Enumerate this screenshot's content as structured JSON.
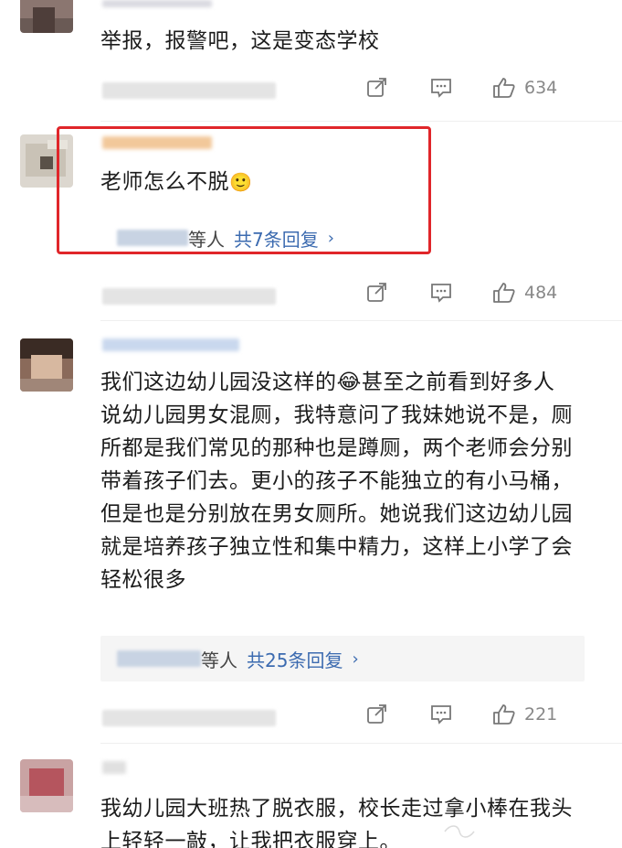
{
  "comments": [
    {
      "text": "举报，报警吧，这是变态学校",
      "likes": "634"
    },
    {
      "text": "老师怎么不脱",
      "emoji": "🙂",
      "replies": {
        "suffix": "等人",
        "link": "共7条回复",
        "chevron": "›"
      },
      "likes": "484"
    },
    {
      "text": "我们这边幼儿园没这样的😂甚至之前看到好多人说幼儿园男女混厕，我特意问了我妹她说不是，厕所都是我们常见的那种也是蹲厕，两个老师会分别带着孩子们去。更小的孩子不能独立的有小马桶，但是也是分别放在男女厕所。她说我们这边幼儿园就是培养孩子独立性和集中精力，这样上小学了会轻松很多",
      "replies": {
        "suffix": "等人",
        "link": "共25条回复",
        "chevron": "›"
      },
      "likes": "221"
    },
    {
      "text": "我幼儿园大班热了脱衣服，校长走过拿小棒在我头上轻轻一敲，让我把衣服穿上。"
    }
  ],
  "icons": {
    "share": "share-icon",
    "comment": "comment-icon",
    "like": "thumbs-up-icon"
  },
  "colors": {
    "highlight_border": "#e0262a",
    "reply_link": "#3c6bb0",
    "meta_gray": "#888888"
  }
}
